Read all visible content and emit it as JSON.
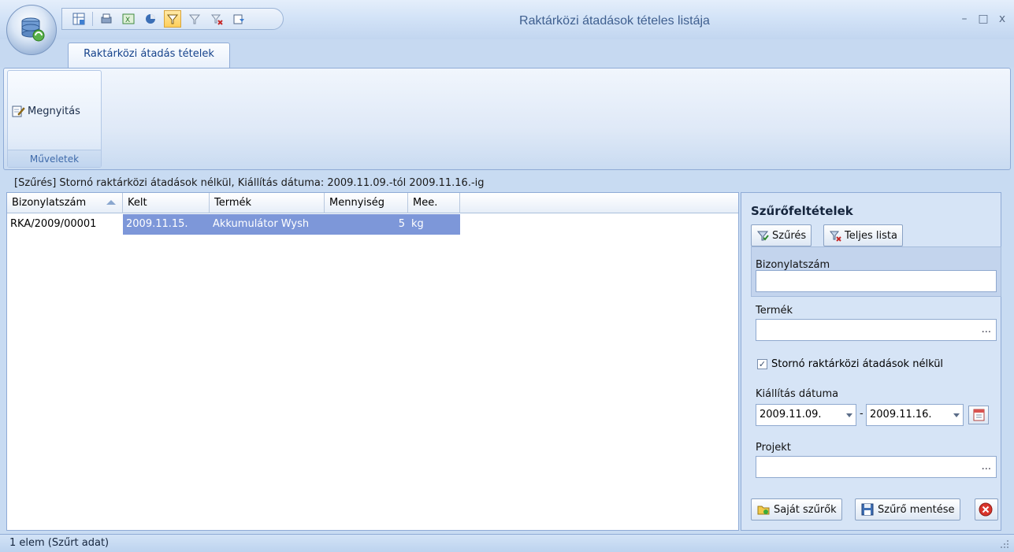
{
  "window": {
    "title": "Raktárközi átadások tételes listája",
    "minimize": "–",
    "maximize": "□",
    "close": "x"
  },
  "tabs": [
    {
      "label": "Raktárközi átadás tételek"
    }
  ],
  "ribbon": {
    "group_label": "Műveletek",
    "open_button": "Megnyitás"
  },
  "filter_status": "[Szűrés]  Stornó raktárközi átadások nélkül, Kiállítás dátuma: 2009.11.09.-tól  2009.11.16.-ig",
  "grid": {
    "columns": [
      "Bizonylatszám",
      "Kelt",
      "Termék",
      "Mennyiség",
      "Mee."
    ],
    "rows": [
      {
        "bizonylatszam": "RKA/2009/00001",
        "kelt": "2009.11.15.",
        "termek": "Akkumulátor Wysh",
        "mennyiseg": "5",
        "mee": "kg"
      }
    ]
  },
  "panel": {
    "title": "Szűrőfeltételek",
    "filter_button": "Szűrés",
    "full_list_button": "Teljes lista",
    "doc_number_label": "Bizonylatszám",
    "doc_number_value": "",
    "product_label": "Termék",
    "product_value": "",
    "ellipsis": "...",
    "storno_label": "Stornó raktárközi átadások nélkül",
    "storno_checked": "✓",
    "date_label": "Kiállítás dátuma",
    "date_from": "2009.11.09.",
    "date_sep": "-",
    "date_to": "2009.11.16.",
    "project_label": "Projekt",
    "project_value": "",
    "own_filters_button": "Saját szűrők",
    "save_filter_button": "Szűrő mentése"
  },
  "statusbar": {
    "text": "1 elem (Szűrt adat)"
  },
  "colors": {
    "accent": "#15428b",
    "selection": "#7d97d9",
    "panel_bg": "#d6e4f6"
  }
}
